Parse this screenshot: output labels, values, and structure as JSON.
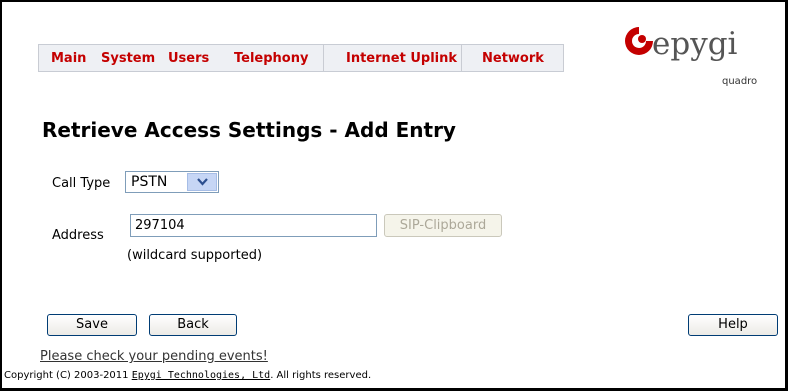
{
  "nav": {
    "items": [
      {
        "label": "Main"
      },
      {
        "label": "System"
      },
      {
        "label": "Users"
      },
      {
        "label": "Telephony"
      },
      {
        "label": "Internet Uplink"
      },
      {
        "label": "Network"
      }
    ],
    "color": "#c40000"
  },
  "logo": {
    "brand": "epygi",
    "sub": "quadro",
    "accent": "#c40000"
  },
  "page": {
    "title": "Retrieve Access Settings - Add Entry"
  },
  "form": {
    "call_type_label": "Call Type",
    "call_type_value": "PSTN",
    "address_label": "Address",
    "address_value": "297104",
    "sip_clipboard_label": "SIP-Clipboard",
    "wildcard_note": "(wildcard supported)"
  },
  "buttons": {
    "save": "Save",
    "back": "Back",
    "help": "Help"
  },
  "footer": {
    "pending_link": "Please check your pending events!",
    "copyright_prefix": "Copyright (C) 2003-2011 ",
    "copyright_link": "Epygi Technologies, Ltd",
    "copyright_suffix": ". All rights reserved."
  }
}
